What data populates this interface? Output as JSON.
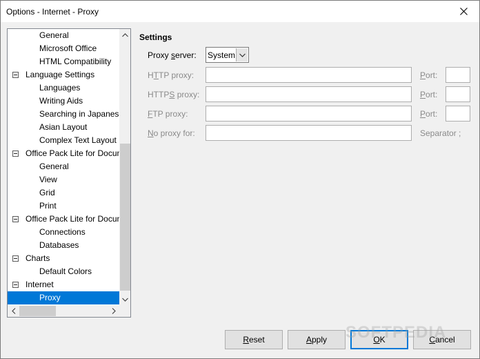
{
  "window": {
    "title": "Options - Internet - Proxy"
  },
  "tree": {
    "rows": [
      {
        "label": "General",
        "level": 1
      },
      {
        "label": "Microsoft Office",
        "level": 1
      },
      {
        "label": "HTML Compatibility",
        "level": 1
      },
      {
        "label": "Language Settings",
        "level": 0,
        "expanded": true
      },
      {
        "label": "Languages",
        "level": 1
      },
      {
        "label": "Writing Aids",
        "level": 1
      },
      {
        "label": "Searching in Japanese",
        "level": 1
      },
      {
        "label": "Asian Layout",
        "level": 1
      },
      {
        "label": "Complex Text Layout",
        "level": 1
      },
      {
        "label": "Office Pack Lite for Documents",
        "level": 0,
        "expanded": true
      },
      {
        "label": "General",
        "level": 1
      },
      {
        "label": "View",
        "level": 1
      },
      {
        "label": "Grid",
        "level": 1
      },
      {
        "label": "Print",
        "level": 1
      },
      {
        "label": "Office Pack Lite for Documents",
        "level": 0,
        "expanded": true
      },
      {
        "label": "Connections",
        "level": 1
      },
      {
        "label": "Databases",
        "level": 1
      },
      {
        "label": "Charts",
        "level": 0,
        "expanded": true
      },
      {
        "label": "Default Colors",
        "level": 1
      },
      {
        "label": "Internet",
        "level": 0,
        "expanded": true
      },
      {
        "label": "Proxy",
        "level": 1,
        "selected": true
      }
    ],
    "selection_color": "#0078d7"
  },
  "settings": {
    "heading": "Settings",
    "proxy_server": {
      "label_pre": "Proxy ",
      "label_ul": "s",
      "label_post": "erver:",
      "value": "System"
    },
    "http_proxy": {
      "label_pre": "H",
      "label_ul": "T",
      "label_post": "TP proxy:",
      "value": ""
    },
    "https_proxy": {
      "label_pre": "HTTP",
      "label_ul": "S",
      "label_post": " proxy:",
      "value": ""
    },
    "ftp_proxy": {
      "label_pre": "",
      "label_ul": "F",
      "label_post": "TP proxy:",
      "value": ""
    },
    "no_proxy": {
      "label_pre": "",
      "label_ul": "N",
      "label_post": "o proxy for:",
      "value": ""
    },
    "port_label_ul": "P",
    "port_label_post": "ort:",
    "separator_label": "Separator ;"
  },
  "buttons": {
    "reset": {
      "pre": "",
      "ul": "R",
      "post": "eset"
    },
    "apply": {
      "pre": "",
      "ul": "A",
      "post": "pply"
    },
    "ok": {
      "pre": "",
      "ul": "O",
      "post": "K"
    },
    "cancel": {
      "pre": "",
      "ul": "C",
      "post": "ancel"
    }
  },
  "watermark": "SOFTPEDIA",
  "icons": {
    "close": "close-icon",
    "dropdown": "chevron-down-icon",
    "scroll_up": "chevron-up-icon",
    "scroll_down": "chevron-down-icon",
    "scroll_left": "chevron-left-icon",
    "scroll_right": "chevron-right-icon",
    "collapse": "minus-box-icon"
  }
}
